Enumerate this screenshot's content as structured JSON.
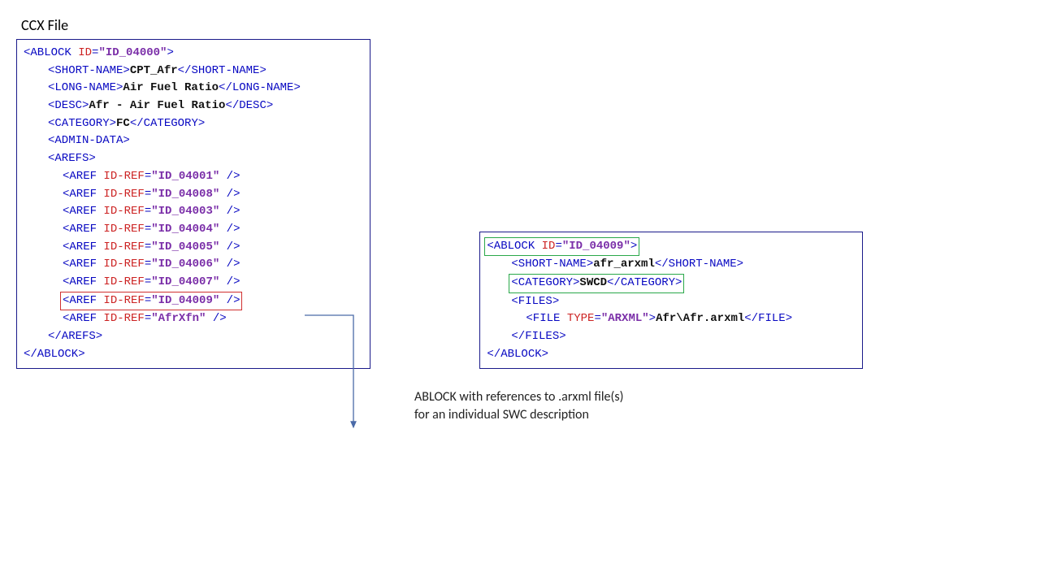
{
  "title": "CCX File",
  "top": {
    "ablock_open_pre": "<ABLOCK ",
    "ablock_attr": "ID",
    "ablock_eq": "=",
    "ablock_val": "\"ID_04000\"",
    "ablock_open_post": ">",
    "short_name_open": "<SHORT-NAME>",
    "short_name_text": "CPT_Afr",
    "short_name_close": "</SHORT-NAME>",
    "long_name_open": "<LONG-NAME>",
    "long_name_text": "Air Fuel Ratio",
    "long_name_close": "</LONG-NAME>",
    "desc_open": "<DESC>",
    "desc_text": "Afr - Air Fuel Ratio",
    "desc_close": "</DESC>",
    "cat_open": "<CATEGORY>",
    "cat_text": "FC",
    "cat_close": "</CATEGORY>",
    "admin_data": "<ADMIN-DATA>",
    "arefs_open": "<AREFS>",
    "aref_pre": "<AREF ",
    "aref_attr": "ID-REF",
    "aref_eq": "=",
    "aref_post": " />",
    "aref_vals": [
      "\"ID_04001\"",
      "\"ID_04008\"",
      "\"ID_04003\"",
      "\"ID_04004\"",
      "\"ID_04005\"",
      "\"ID_04006\"",
      "\"ID_04007\"",
      "\"ID_04009\"",
      "\"AfrXfn\""
    ],
    "arefs_close": "</AREFS>",
    "ablock_close": "</ABLOCK>"
  },
  "bottom": {
    "ablock_open_pre": "<ABLOCK ",
    "ablock_attr": "ID",
    "ablock_eq": "=",
    "ablock_val": "\"ID_04009\"",
    "ablock_open_post": ">",
    "short_name_open": "<SHORT-NAME>",
    "short_name_text": "afr_arxml",
    "short_name_close": "</SHORT-NAME>",
    "cat_open": "<CATEGORY>",
    "cat_text": "SWCD",
    "cat_close": "</CATEGORY>",
    "files_open": "<FILES>",
    "file_open_pre": "<FILE ",
    "file_attr": "TYPE",
    "file_eq": "=",
    "file_val": "\"ARXML\"",
    "file_open_post": ">",
    "file_text": "Afr\\Afr.arxml",
    "file_close": "</FILE>",
    "files_close": "</FILES>",
    "ablock_close": "</ABLOCK>"
  },
  "caption": {
    "line1": "ABLOCK with references to .arxml file(s)",
    "line2": "for an individual SWC description"
  }
}
